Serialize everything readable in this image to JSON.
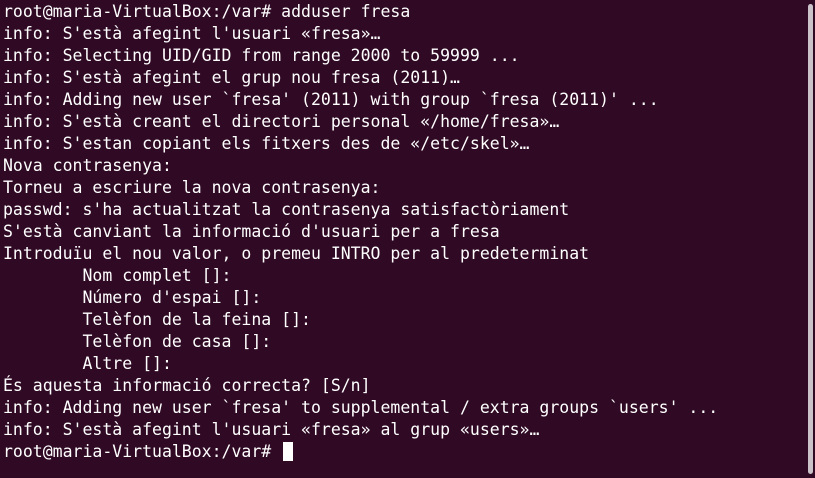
{
  "terminal": {
    "lines": [
      "root@maria-VirtualBox:/var# adduser fresa",
      "info: S'està afegint l'usuari «fresa»…",
      "info: Selecting UID/GID from range 2000 to 59999 ...",
      "info: S'està afegint el grup nou fresa (2011)…",
      "info: Adding new user `fresa' (2011) with group `fresa (2011)' ...",
      "info: S'està creant el directori personal «/home/fresa»…",
      "info: S'estan copiant els fitxers des de «/etc/skel»…",
      "Nova contrasenya:",
      "Torneu a escriure la nova contrasenya:",
      "passwd: s'ha actualitzat la contrasenya satisfactòriament",
      "S'està canviant la informació d'usuari per a fresa",
      "Introduïu el nou valor, o premeu INTRO per al predeterminat",
      "        Nom complet []:",
      "        Número d'espai []:",
      "        Telèfon de la feina []:",
      "        Telèfon de casa []:",
      "        Altre []:",
      "És aquesta informació correcta? [S/n]",
      "info: Adding new user `fresa' to supplemental / extra groups `users' ...",
      "info: S'està afegint l'usuari «fresa» al grup «users»…"
    ],
    "prompt": "root@maria-VirtualBox:/var# ",
    "background_color": "#300a24",
    "text_color": "#ffffff"
  }
}
